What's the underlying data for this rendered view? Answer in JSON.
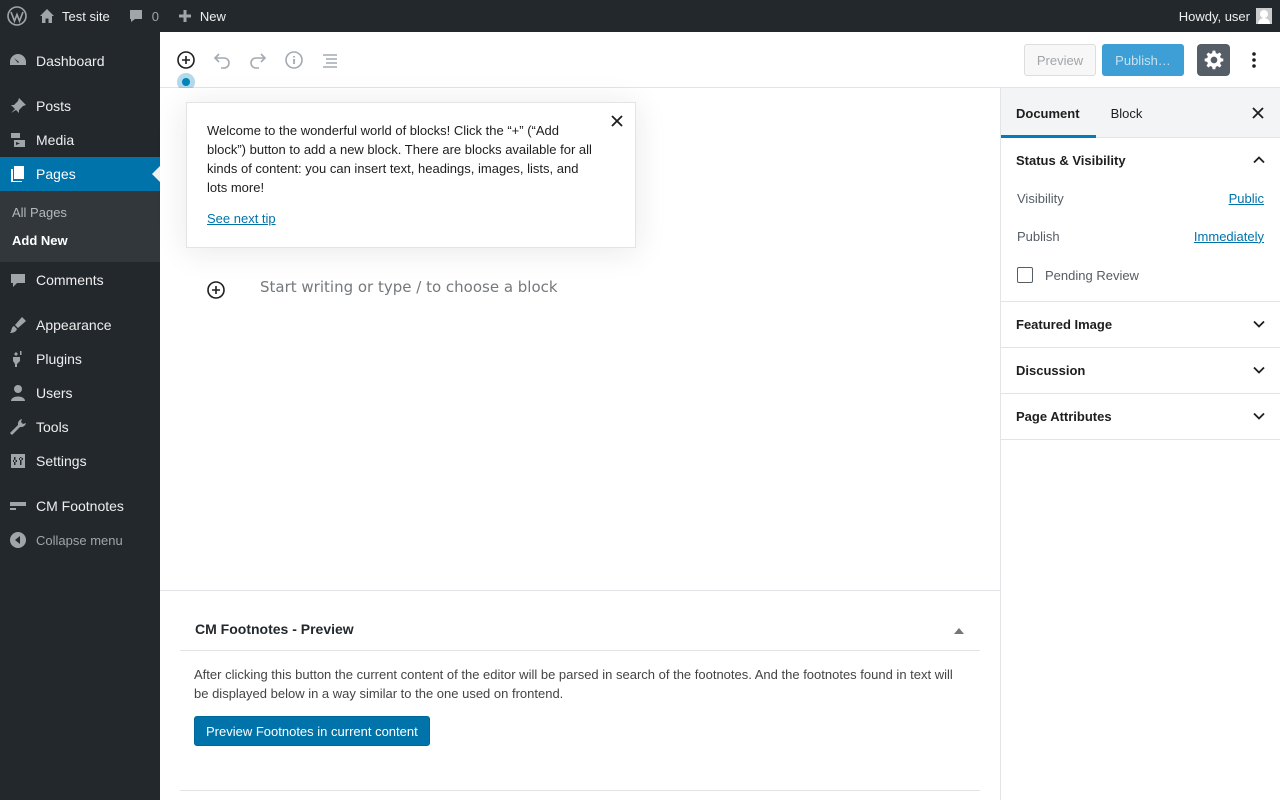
{
  "admin_bar": {
    "site_name": "Test site",
    "comment_count": "0",
    "new_label": "New",
    "greeting": "Howdy, user"
  },
  "admin_menu": {
    "items": [
      {
        "label": "Dashboard",
        "icon": "dashboard-icon"
      },
      {
        "label": "Posts",
        "icon": "pin-icon"
      },
      {
        "label": "Media",
        "icon": "media-icon"
      },
      {
        "label": "Pages",
        "icon": "pages-icon"
      },
      {
        "label": "Comments",
        "icon": "comment-icon"
      },
      {
        "label": "Appearance",
        "icon": "brush-icon"
      },
      {
        "label": "Plugins",
        "icon": "plug-icon"
      },
      {
        "label": "Users",
        "icon": "user-icon"
      },
      {
        "label": "Tools",
        "icon": "wrench-icon"
      },
      {
        "label": "Settings",
        "icon": "sliders-icon"
      },
      {
        "label": "CM Footnotes",
        "icon": "footnotes-icon"
      }
    ],
    "submenu": [
      "All Pages",
      "Add New"
    ],
    "collapse_label": "Collapse menu"
  },
  "toolbar": {
    "preview_label": "Preview",
    "publish_label": "Publish…"
  },
  "tip": {
    "text": "Welcome to the wonderful world of blocks! Click the “+” (“Add block”) button to add a new block. There are blocks available for all kinds of content: you can insert text, headings, images, lists, and lots more!",
    "link": "See next tip"
  },
  "editor": {
    "placeholder": "Start writing or type / to choose a block"
  },
  "metabox": {
    "title": "CM Footnotes - Preview",
    "description": "After clicking this button the current content of the editor will be parsed in search of the footnotes. And the footnotes found in text will be displayed below in a way similar to the one used on frontend.",
    "button_label": "Preview Footnotes in current content"
  },
  "sidebar": {
    "tabs": [
      "Document",
      "Block"
    ],
    "status_panel": {
      "title": "Status & Visibility",
      "visibility_label": "Visibility",
      "visibility_value": "Public",
      "publish_label": "Publish",
      "publish_value": "Immediately",
      "pending_label": "Pending Review"
    },
    "panels": [
      "Featured Image",
      "Discussion",
      "Page Attributes"
    ]
  },
  "colors": {
    "admin_dark": "#23282d",
    "admin_accent": "#0073aa",
    "publish_button": "#3d9fd5",
    "settings_button": "#555d66"
  }
}
